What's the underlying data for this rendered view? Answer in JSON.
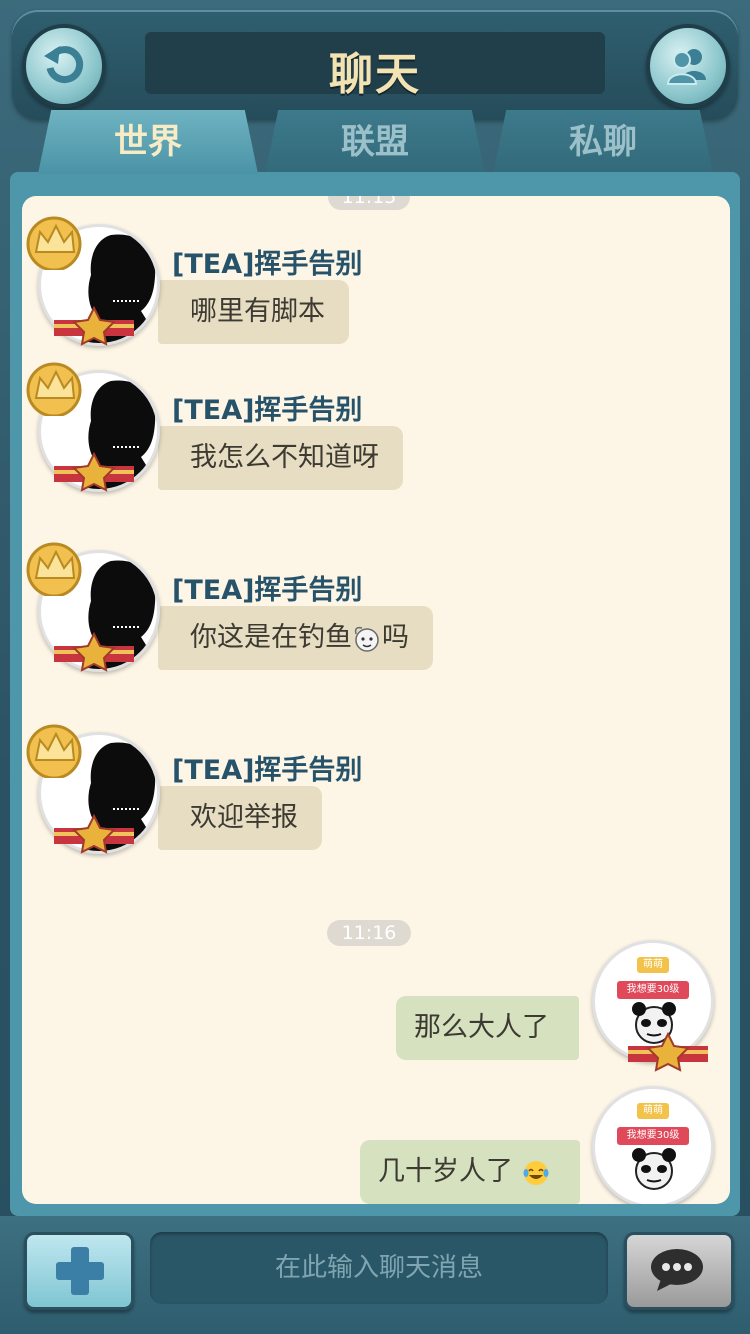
{
  "header": {
    "title": "聊天"
  },
  "tabs": [
    {
      "label": "世界",
      "active": true
    },
    {
      "label": "联盟",
      "active": false
    },
    {
      "label": "私聊",
      "active": false
    }
  ],
  "timestamps": {
    "top_partial": "11:15",
    "middle": "11:16"
  },
  "messages": [
    {
      "sender": "[TEA]挥手告别",
      "text": "哪里有脚本"
    },
    {
      "sender": "[TEA]挥手告别",
      "text": "我怎么不知道呀"
    },
    {
      "sender": "[TEA]挥手告别",
      "text": "你这是在钓鱼",
      "text_after": "吗"
    },
    {
      "sender": "[TEA]挥手告别",
      "text": "欢迎举报"
    }
  ],
  "my_messages": [
    {
      "text": "那么大人了"
    },
    {
      "text": "几十岁人了"
    }
  ],
  "my_avatar_badges": {
    "top": "萌萌",
    "bottom": "我想要30级"
  },
  "footer": {
    "input_placeholder": "在此输入聊天消息"
  },
  "colors": {
    "frame": "#2c5566",
    "chat_bg": "#fdf6e7",
    "other_bubble": "#e6ddc3",
    "my_bubble": "#d5e1bf",
    "sender_name": "#27536a",
    "title": "#f4e3b2"
  },
  "icons": {
    "back": "back-arrow-icon",
    "friends": "friends-icon",
    "plus": "plus-icon",
    "send": "chat-bubble-icon",
    "crown": "crown-icon",
    "rank": "rank-ribbon-icon"
  }
}
